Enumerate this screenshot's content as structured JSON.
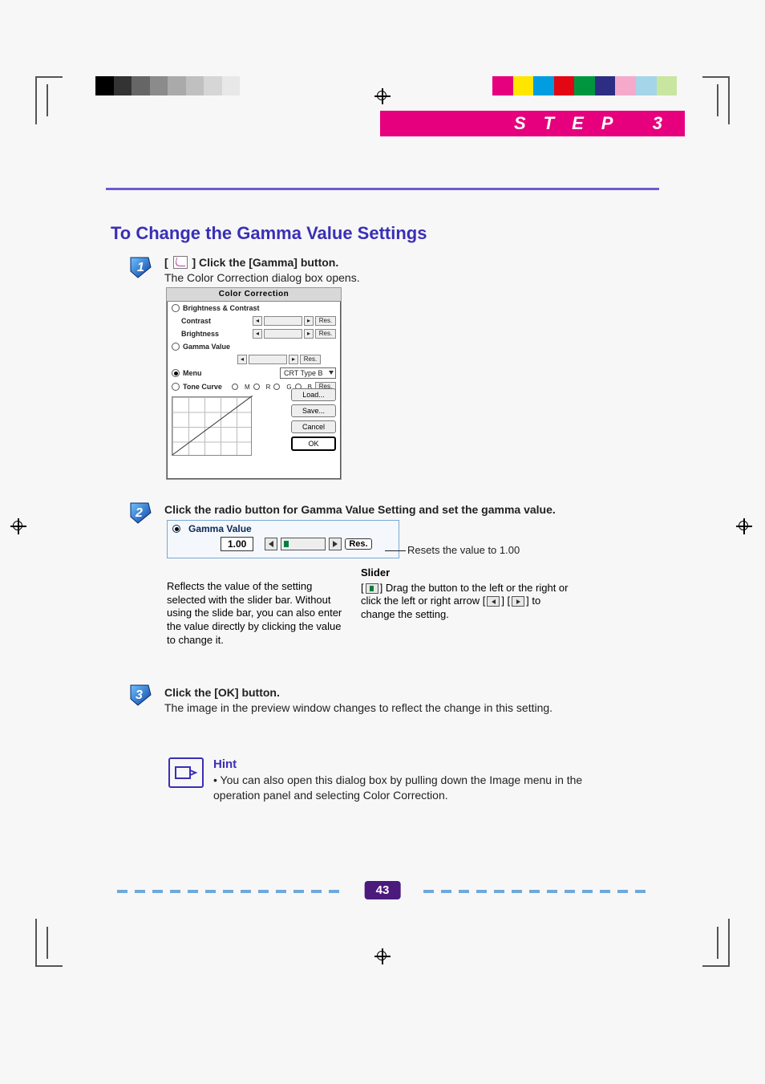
{
  "header": {
    "step_label": "STEP 3"
  },
  "title": "To Change the Gamma Value Settings",
  "step1": {
    "instruction_prefix": "[",
    "instruction_suffix": "] Click the [Gamma] button.",
    "note": "The Color Correction dialog box opens."
  },
  "dialog": {
    "title": "Color Correction",
    "brightness_contrast": "Brightness & Contrast",
    "contrast": "Contrast",
    "brightness": "Brightness",
    "gamma_value": "Gamma Value",
    "menu": "Menu",
    "menu_value": "CRT Type B",
    "tone_curve": "Tone Curve",
    "tc_m": "M",
    "tc_r": "R",
    "tc_g": "G",
    "tc_b": "B",
    "res": "Res.",
    "load": "Load...",
    "save": "Save...",
    "cancel": "Cancel",
    "ok": "OK"
  },
  "step2": {
    "instruction": "Click the radio button for Gamma Value Setting and set the gamma value.",
    "gamma_label": "Gamma Value",
    "gamma_value": "1.00",
    "res": "Res.",
    "reset_note": "Resets the value to 1.00",
    "value_explain": "Reflects the value of the setting selected with the slider bar. Without using the slide bar, you can also enter the value directly by clicking the value to change it.",
    "slider_hdr": "Slider",
    "slider_explain_a": "[",
    "slider_explain_b": "] Drag the button to the left or the right or click the left or right arrow [",
    "slider_explain_c": "] [",
    "slider_explain_d": "] to change the setting."
  },
  "step3": {
    "instruction": "Click the [OK] button.",
    "note": "The image in the preview window changes to reflect the change in this setting."
  },
  "hint": {
    "title": "Hint",
    "body": "• You can also open this dialog box by pulling down the Image menu in the operation panel and selecting Color Correction."
  },
  "page_number": "43"
}
